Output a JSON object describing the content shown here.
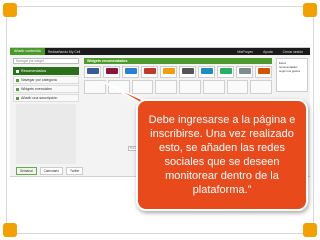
{
  "screenshot": {
    "topbar": {
      "add_label": "Añadir contenido",
      "title": "Rediseñando My Cell",
      "right_items": [
        "MisProyec",
        "Ayuda",
        "Cerrar sesión"
      ]
    },
    "sidebar": {
      "search_placeholder": "Navegar por widget",
      "items": [
        {
          "label": "Recomendados",
          "active": true
        },
        {
          "label": "Navegar por categoría",
          "active": false
        },
        {
          "label": "Widgets exenciales",
          "active": false
        },
        {
          "label": "Añadir una suscripción",
          "active": false
        }
      ]
    },
    "recommended": {
      "header": "Widgets recomendados",
      "tiles": [
        {
          "label": "",
          "color": "#3b5998"
        },
        {
          "label": "",
          "color": "#8a1538"
        },
        {
          "label": "",
          "color": "#2a7fd4"
        },
        {
          "label": "",
          "color": "#c0392b"
        },
        {
          "label": "",
          "color": "#f39c12"
        },
        {
          "label": "",
          "color": "#555555"
        },
        {
          "label": "",
          "color": "#1e8bc3"
        },
        {
          "label": "",
          "color": "#27ae60"
        },
        {
          "label": "",
          "color": "#7f8c8d"
        },
        {
          "label": "",
          "color": "#d35400"
        }
      ],
      "side_note": "Estos recomendados según tus gustos"
    },
    "lower": {
      "field_placeholder": "Buscar",
      "tabs": [
        {
          "label": "Semanal",
          "active": true
        },
        {
          "label": "Calendario",
          "active": false
        },
        {
          "label": "Twitter",
          "active": false
        }
      ]
    }
  },
  "callout": {
    "text": "Debe ingresarse a la página e inscribirse. Una vez realizado esto, se añaden las redes sociales que se deseen monitorear dentro de la plataforma.”",
    "color": "#e84a1c"
  },
  "frame": {
    "accent": "#f4a000"
  }
}
